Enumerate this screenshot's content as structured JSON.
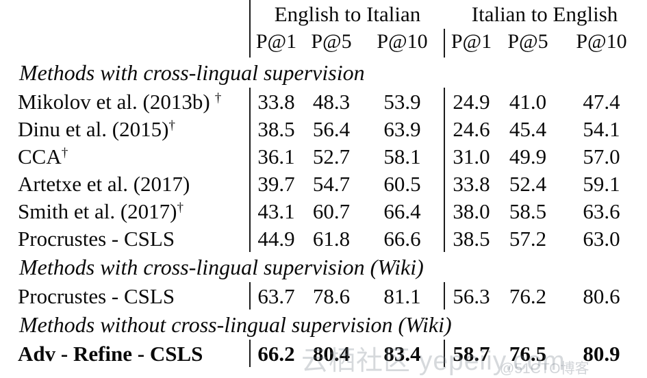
{
  "table": {
    "column_groups": [
      {
        "label": "English to Italian",
        "span": 3
      },
      {
        "label": "Italian to English",
        "span": 3
      }
    ],
    "metric_headers": [
      "P@1",
      "P@5",
      "P@10",
      "P@1",
      "P@5",
      "P@10"
    ],
    "method_column_header": "",
    "sections": [
      {
        "title": "Methods with cross-lingual supervision",
        "rows": [
          {
            "method": "Mikolov et al. (2013b)",
            "dagger": true,
            "dagger_spaced": true,
            "bold": false,
            "values": [
              "33.8",
              "48.3",
              "53.9",
              "24.9",
              "41.0",
              "47.4"
            ]
          },
          {
            "method": "Dinu et al. (2015)",
            "dagger": true,
            "dagger_spaced": false,
            "bold": false,
            "values": [
              "38.5",
              "56.4",
              "63.9",
              "24.6",
              "45.4",
              "54.1"
            ]
          },
          {
            "method": "CCA",
            "dagger": true,
            "dagger_spaced": false,
            "bold": false,
            "values": [
              "36.1",
              "52.7",
              "58.1",
              "31.0",
              "49.9",
              "57.0"
            ]
          },
          {
            "method": "Artetxe et al. (2017)",
            "dagger": false,
            "dagger_spaced": false,
            "bold": false,
            "values": [
              "39.7",
              "54.7",
              "60.5",
              "33.8",
              "52.4",
              "59.1"
            ]
          },
          {
            "method": "Smith et al. (2017)",
            "dagger": true,
            "dagger_spaced": false,
            "bold": false,
            "values": [
              "43.1",
              "60.7",
              "66.4",
              "38.0",
              "58.5",
              "63.6"
            ]
          },
          {
            "method": "Procrustes - CSLS",
            "dagger": false,
            "dagger_spaced": false,
            "bold": false,
            "values": [
              "44.9",
              "61.8",
              "66.6",
              "38.5",
              "57.2",
              "63.0"
            ]
          }
        ]
      },
      {
        "title": "Methods with cross-lingual supervision (Wiki)",
        "rows": [
          {
            "method": "Procrustes - CSLS",
            "dagger": false,
            "dagger_spaced": false,
            "bold": false,
            "values": [
              "63.7",
              "78.6",
              "81.1",
              "56.3",
              "76.2",
              "80.6"
            ]
          }
        ]
      },
      {
        "title": "Methods without cross-lingual supervision (Wiki)",
        "rows": [
          {
            "method": "Adv - Refine - CSLS",
            "dagger": false,
            "dagger_spaced": false,
            "bold": true,
            "values": [
              "66.2",
              "80.4",
              "83.4",
              "58.7",
              "76.5",
              "80.9"
            ]
          }
        ]
      }
    ]
  },
  "watermark": {
    "main": "云栖社区 yepeiiy.com",
    "sub": "@51CTO博客"
  },
  "colors": {
    "rule": "#2a2a2a",
    "text": "#0a0a0a",
    "watermark": "#78828c"
  }
}
